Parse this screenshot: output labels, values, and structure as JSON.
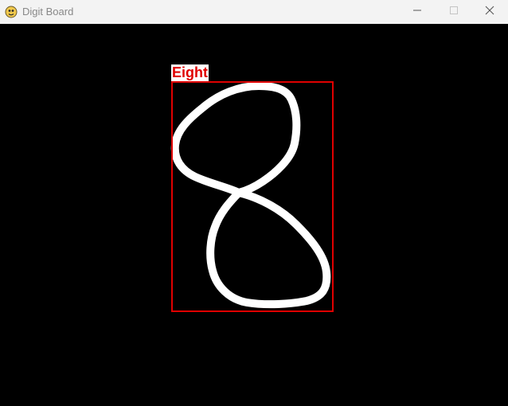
{
  "window": {
    "title": "Digit Board",
    "app_icon": "pygame-snake-icon",
    "controls": {
      "minimize_icon": "minimize-icon",
      "maximize_icon": "maximize-icon",
      "close_icon": "close-icon"
    }
  },
  "canvas": {
    "background": "#000000",
    "stroke_color": "#ffffff",
    "prediction": {
      "label": "Eight",
      "label_color": "#e00000",
      "label_background": "#ffffff",
      "box_color": "#e00000"
    }
  }
}
